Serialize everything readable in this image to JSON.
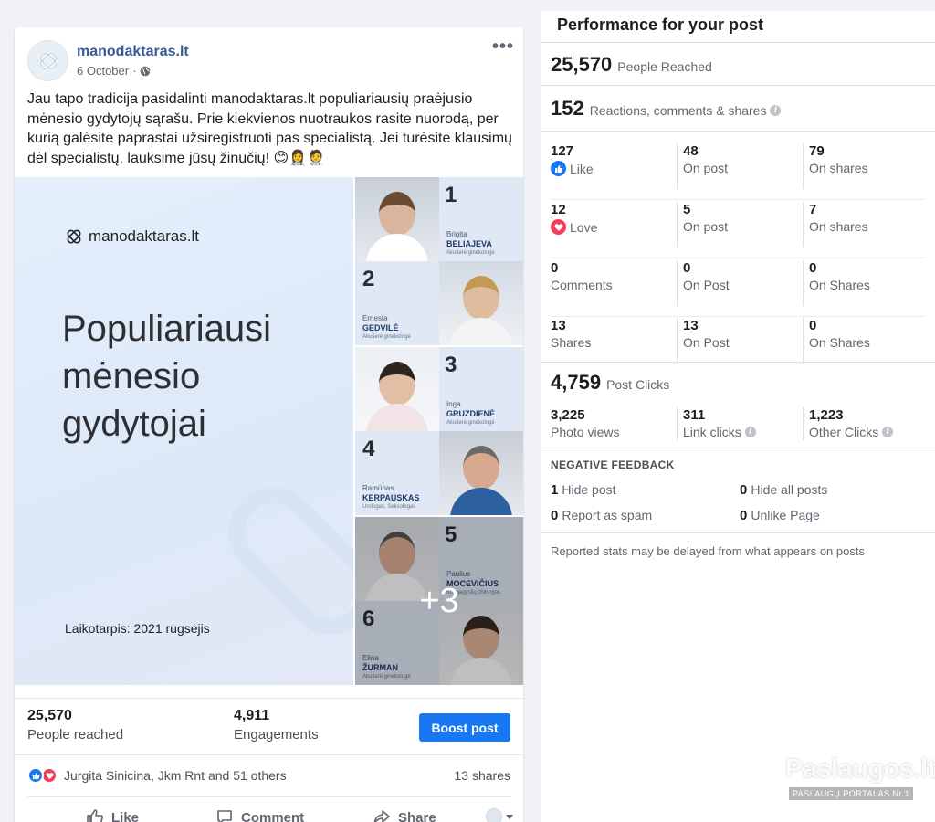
{
  "post": {
    "page_name": "manodaktaras.lt",
    "date": "6 October",
    "date_separator": "·",
    "more_label": "•••",
    "text": "Jau tapo tradicija pasidalinti manodaktaras.lt populiariausių praėjusio mėnesio gydytojų sąrašu. Prie kiekvienos nuotraukos rasite nuorodą, per kurią galėsite paprastai užsiregistruoti pas specialistą. Jei turėsite klausimų dėl specialistų, lauksime jūsų žinučių! 😊👩‍⚕️🧑‍⚕️",
    "image": {
      "logo_text": "manodaktaras.lt",
      "title_lines": [
        "Populiariausi",
        "mėnesio",
        "gydytojai"
      ],
      "period": "Laikotarpis: 2021 rugsėjis",
      "more_count": "+3",
      "doctors": [
        {
          "rank": "1",
          "first": "Brigita",
          "last": "BELIAJEVA",
          "specialty": "Akušerė ginekologė"
        },
        {
          "rank": "2",
          "first": "Ernesta",
          "last": "GEDVILĖ",
          "specialty": "Akušerė ginekologė"
        },
        {
          "rank": "3",
          "first": "Inga",
          "last": "GRUZDIENĖ",
          "specialty": "Akušerė ginekologė"
        },
        {
          "rank": "4",
          "first": "Ramūnas",
          "last": "KERPAUSKAS",
          "specialty": "Urologas, Seksologas"
        },
        {
          "rank": "5",
          "first": "Paulius",
          "last": "MOCEVIČIUS",
          "specialty": "Kraujagyslių chirurgas"
        },
        {
          "rank": "6",
          "first": "Elina",
          "last": "ŽURMAN",
          "specialty": "Akušerė ginekologė"
        }
      ]
    },
    "stats": {
      "reached_value": "25,570",
      "reached_label": "People reached",
      "engagements_value": "4,911",
      "engagements_label": "Engagements",
      "boost_label": "Boost post"
    },
    "reactions": {
      "names": "Jurgita Sinicina, Jkm Rnt and 51 others",
      "shares": "13 shares"
    },
    "actions": {
      "like": "Like",
      "comment": "Comment",
      "share": "Share"
    }
  },
  "performance": {
    "title": "Performance for your post",
    "reached_value": "25,570",
    "reached_label": "People Reached",
    "rcs_value": "152",
    "rcs_label": "Reactions, comments & shares",
    "rows": [
      {
        "c1v": "127",
        "c1l": "Like",
        "c2v": "48",
        "c2l": "On post",
        "c3v": "79",
        "c3l": "On shares"
      },
      {
        "c1v": "12",
        "c1l": "Love",
        "c2v": "5",
        "c2l": "On post",
        "c3v": "7",
        "c3l": "On shares"
      },
      {
        "c1v": "0",
        "c1l": "Comments",
        "c2v": "0",
        "c2l": "On Post",
        "c3v": "0",
        "c3l": "On Shares"
      },
      {
        "c1v": "13",
        "c1l": "Shares",
        "c2v": "13",
        "c2l": "On Post",
        "c3v": "0",
        "c3l": "On Shares"
      }
    ],
    "clicks_value": "4,759",
    "clicks_label": "Post Clicks",
    "photo_views_value": "3,225",
    "photo_views_label": "Photo views",
    "link_clicks_value": "311",
    "link_clicks_label": "Link clicks",
    "other_clicks_value": "1,223",
    "other_clicks_label": "Other Clicks",
    "negative_title": "NEGATIVE FEEDBACK",
    "negative": [
      {
        "value": "1",
        "label": "Hide post"
      },
      {
        "value": "0",
        "label": "Hide all posts"
      },
      {
        "value": "0",
        "label": "Report as spam"
      },
      {
        "value": "0",
        "label": "Unlike Page"
      }
    ],
    "note": "Reported stats may be delayed from what appears on posts",
    "info_glyph": "i"
  },
  "watermark": {
    "title": "Paslaugos.lt",
    "subtitle": "PASLAUGŲ PORTALAS Nr.1"
  },
  "colors": {
    "facebook_blue": "#1877f2",
    "page_link": "#385898",
    "love_red": "#f33e58"
  }
}
